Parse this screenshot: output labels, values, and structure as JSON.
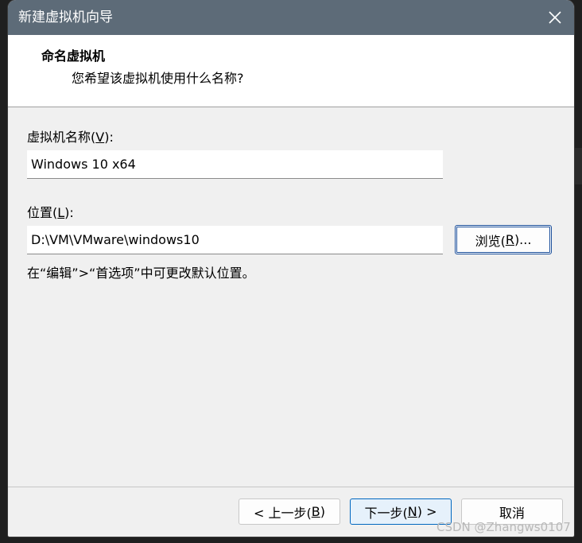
{
  "window": {
    "title": "新建虚拟机向导"
  },
  "header": {
    "title": "命名虚拟机",
    "subtitle": "您希望该虚拟机使用什么名称?"
  },
  "form": {
    "name_label_prefix": "虚拟机名称(",
    "name_label_key": "V",
    "name_label_suffix": "):",
    "name_value": "Windows 10 x64",
    "location_label_prefix": "位置(",
    "location_label_key": "L",
    "location_label_suffix": "):",
    "location_value": "D:\\VM\\VMware\\windows10",
    "browse_prefix": "浏览(",
    "browse_key": "R",
    "browse_suffix": ")...",
    "hint": "在“编辑”>“首选项”中可更改默认位置。"
  },
  "footer": {
    "back_prefix": "< 上一步(",
    "back_key": "B",
    "back_suffix": ")",
    "next_prefix": "下一步(",
    "next_key": "N",
    "next_suffix": ") >",
    "cancel_label": "取消"
  },
  "watermark": "CSDN @Zhangws0107",
  "colors": {
    "titlebar": "#5d6b78",
    "default_button_border": "#0067c0"
  }
}
